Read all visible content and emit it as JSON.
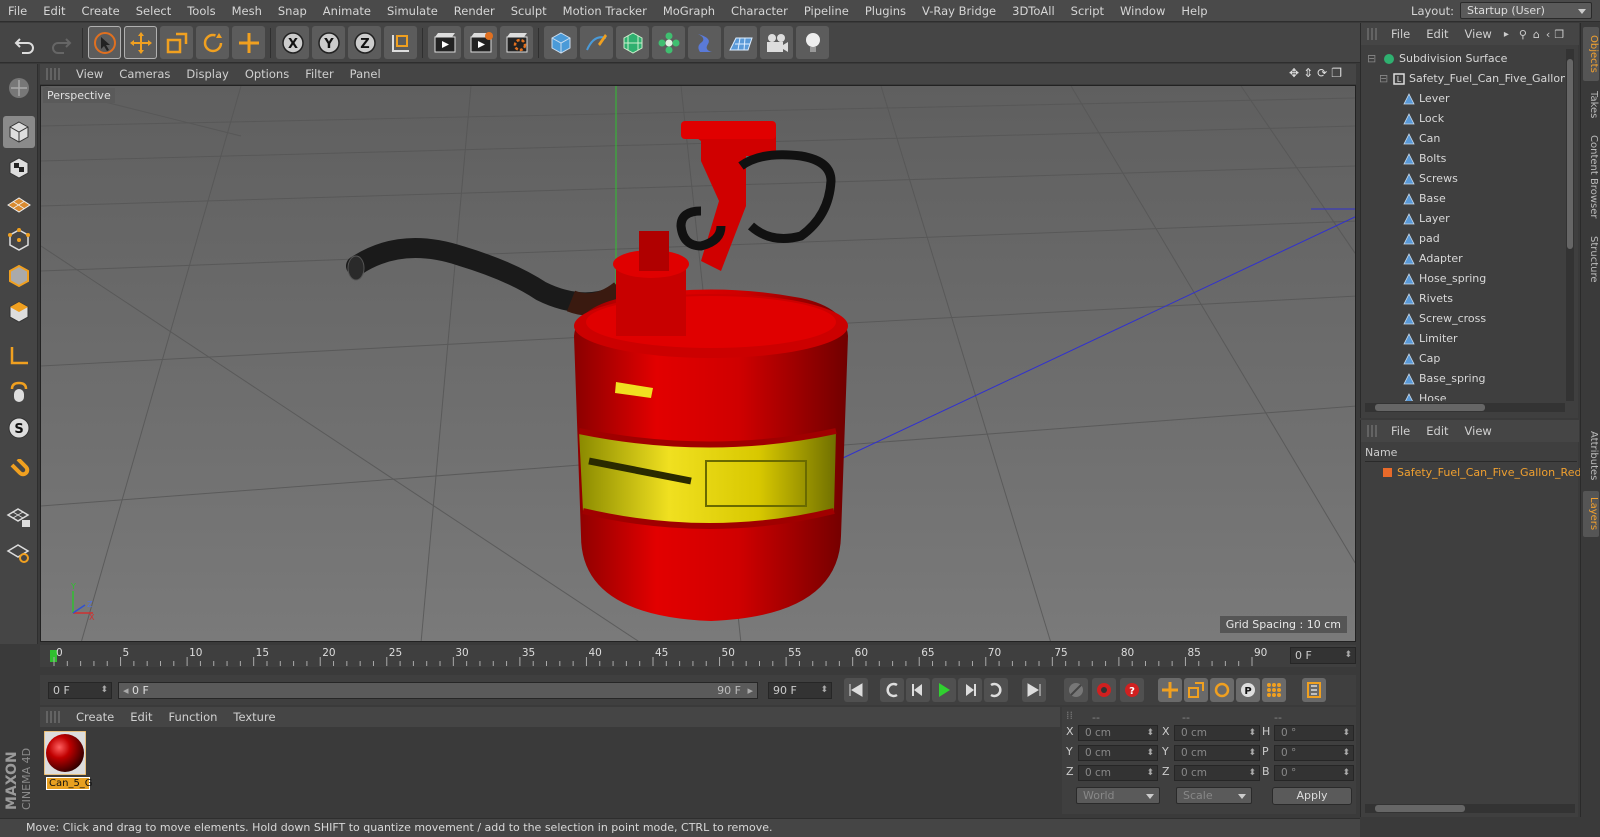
{
  "menu": [
    "File",
    "Edit",
    "Create",
    "Select",
    "Tools",
    "Mesh",
    "Snap",
    "Animate",
    "Simulate",
    "Render",
    "Sculpt",
    "Motion Tracker",
    "MoGraph",
    "Character",
    "Pipeline",
    "Plugins",
    "V-Ray Bridge",
    "3DToAll",
    "Script",
    "Window",
    "Help"
  ],
  "layout": {
    "label": "Layout:",
    "value": "Startup (User)"
  },
  "toolbar_icons": [
    "undo-icon",
    "redo-icon",
    "live-selection-icon",
    "move-icon",
    "scale-icon",
    "rotate-icon",
    "recent-tool-icon",
    "x-axis-icon",
    "y-axis-icon",
    "z-axis-icon",
    "world-coordinate-icon",
    "render-view-icon",
    "render-picture-viewer-icon",
    "edit-render-settings-icon",
    "cube-icon",
    "pen-spline-icon",
    "subdivision-icon",
    "mograph-cloner-icon",
    "deformer-icon",
    "floor-icon",
    "camera-icon",
    "light-icon"
  ],
  "toolbar_letters": {
    "x": "X",
    "y": "Y",
    "z": "Z"
  },
  "viewport": {
    "menu": [
      "View",
      "Cameras",
      "Display",
      "Options",
      "Filter",
      "Panel"
    ],
    "label": "Perspective",
    "grid_spacing": "Grid Spacing : 10 cm",
    "axis_x": "X",
    "axis_y": "Y",
    "axis_z": "Z"
  },
  "timeline": {
    "ticks": [
      "0",
      "5",
      "10",
      "15",
      "20",
      "25",
      "30",
      "35",
      "40",
      "45",
      "50",
      "55",
      "60",
      "65",
      "70",
      "75",
      "80",
      "85",
      "90"
    ],
    "current_frame": "0 F"
  },
  "transport": {
    "start": "0 F",
    "range_start": "0 F",
    "range_end": "90 F",
    "end": "90 F"
  },
  "material_manager": {
    "menu": [
      "Create",
      "Edit",
      "Function",
      "Texture"
    ],
    "material_name": "Can_5_G"
  },
  "coordinates": {
    "header": [
      "--",
      "--",
      "--"
    ],
    "rows": [
      {
        "a": "X",
        "av": "0 cm",
        "b": "X",
        "bv": "0 cm",
        "c": "H",
        "cv": "0 °"
      },
      {
        "a": "Y",
        "av": "0 cm",
        "b": "Y",
        "bv": "0 cm",
        "c": "P",
        "cv": "0 °"
      },
      {
        "a": "Z",
        "av": "0 cm",
        "b": "Z",
        "bv": "0 cm",
        "c": "B",
        "cv": "0 °"
      }
    ],
    "mode": "World",
    "size_mode": "Scale",
    "apply": "Apply"
  },
  "brand": {
    "line1": "MAXON",
    "line2": "CINEMA 4D"
  },
  "status": "Move: Click and drag to move elements. Hold down SHIFT to quantize movement / add to the selection in point mode, CTRL to remove.",
  "object_manager": {
    "menu": [
      "File",
      "Edit",
      "View"
    ],
    "root": "Subdivision Surface",
    "group": "Safety_Fuel_Can_Five_Gallon_",
    "children": [
      "Lever",
      "Lock",
      "Can",
      "Bolts",
      "Screws",
      "Base",
      "Layer",
      "pad",
      "Adapter",
      "Hose_spring",
      "Rivets",
      "Screw_cross",
      "Limiter",
      "Cap",
      "Base_spring",
      "Hose"
    ]
  },
  "layer_manager": {
    "menu": [
      "File",
      "Edit",
      "View"
    ],
    "column": "Name",
    "layer": "Safety_Fuel_Can_Five_Gallon_Red"
  },
  "side_tabs": [
    "Objects",
    "Takes",
    "Content Browser",
    "Structure",
    "Attributes",
    "Layers"
  ]
}
